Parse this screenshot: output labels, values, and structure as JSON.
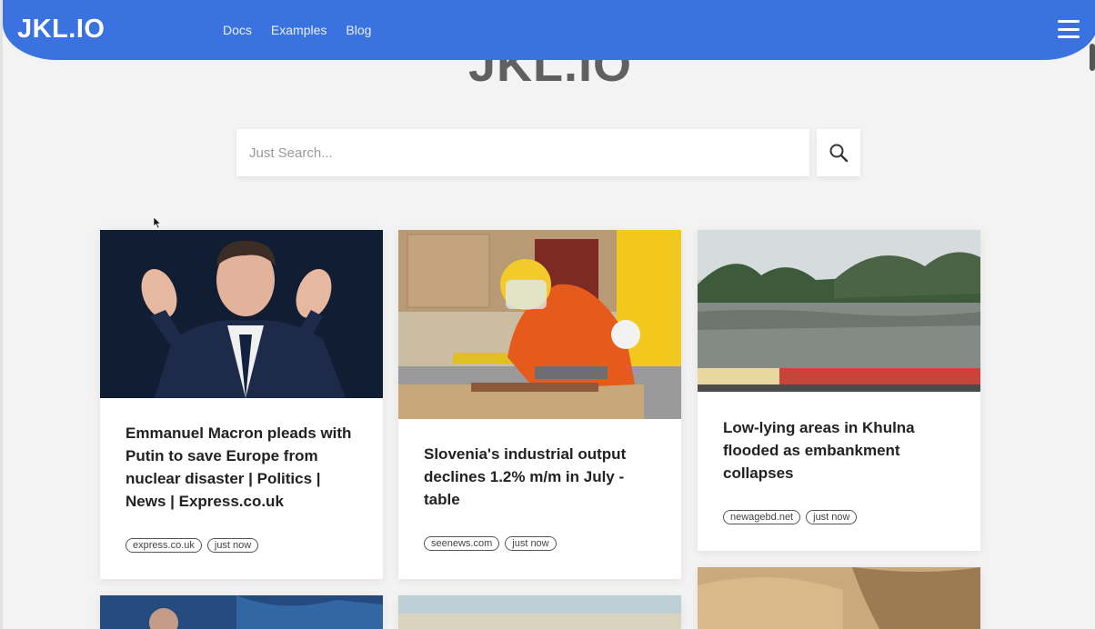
{
  "nav": {
    "brand": "JKL.IO",
    "links": [
      "Docs",
      "Examples",
      "Blog"
    ]
  },
  "hero": {
    "title": "JKL.IO"
  },
  "search": {
    "placeholder": "Just Search..."
  },
  "cards": [
    {
      "title": "Emmanuel Macron pleads with Putin to save Europe from nuclear disaster | Politics | News | Express.co.uk",
      "source": "express.co.uk",
      "time": "just now"
    },
    {
      "title": "Slovenia's industrial output declines 1.2% m/m in July - table",
      "source": "seenews.com",
      "time": "just now"
    },
    {
      "title": "Low-lying areas in Khulna flooded as embankment collapses",
      "source": "newagebd.net",
      "time": "just now"
    }
  ],
  "colors": {
    "accent": "#3a73df",
    "background": "#f3f3f3"
  }
}
